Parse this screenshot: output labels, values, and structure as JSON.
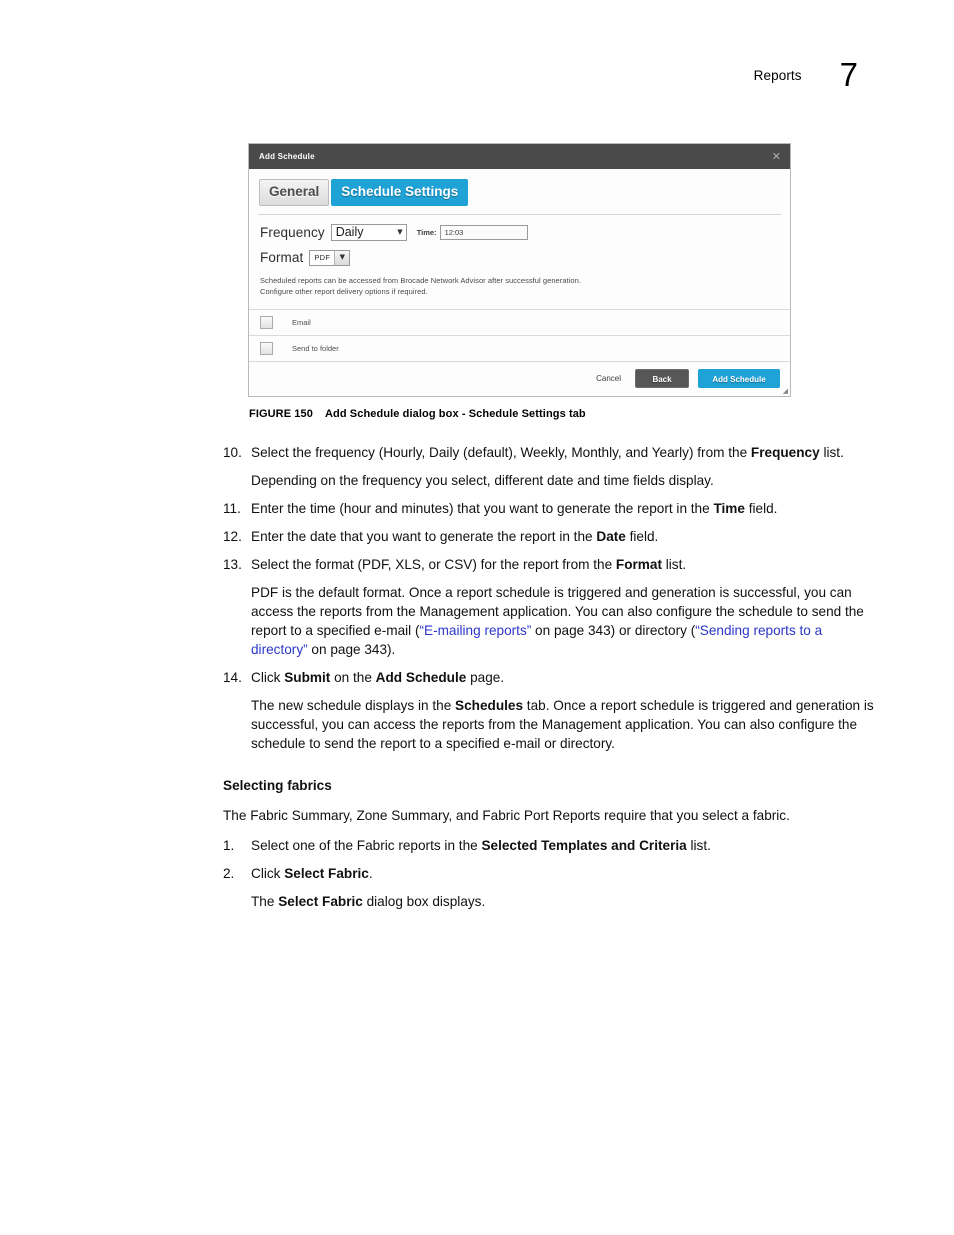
{
  "header": {
    "label": "Reports",
    "chapter_number": "7"
  },
  "dialog": {
    "title": "Add Schedule",
    "close_icon": "close-icon",
    "tabs": [
      {
        "label": "General",
        "active": false
      },
      {
        "label": "Schedule Settings",
        "active": true
      }
    ],
    "frequency": {
      "label": "Frequency",
      "value": "Daily",
      "options": [
        "Hourly",
        "Daily",
        "Weekly",
        "Monthly",
        "Yearly"
      ]
    },
    "time": {
      "label": "Time:",
      "value": "12:03"
    },
    "format": {
      "label": "Format",
      "value": "PDF",
      "options": [
        "PDF",
        "XLS",
        "CSV"
      ]
    },
    "note_line1": "Scheduled reports can be accessed from Brocade Network Advisor after successful generation.",
    "note_line2": "Configure other report delivery options if required.",
    "delivery_options": [
      {
        "label": "Email",
        "checked": false
      },
      {
        "label": "Send to folder",
        "checked": false
      }
    ],
    "buttons": {
      "cancel": "Cancel",
      "back": "Back",
      "submit": "Add Schedule"
    },
    "colors": {
      "titlebar": "#4a4a4a",
      "accent": "#1fa2d6",
      "back_button": "#575757"
    }
  },
  "figure": {
    "number": "FIGURE 150",
    "caption": "Add Schedule dialog box - Schedule Settings tab"
  },
  "steps": {
    "s10": {
      "num": "10.",
      "text_a": "Select the frequency (Hourly, Daily (default), Weekly, Monthly, and Yearly) from the ",
      "bold": "Frequency",
      "text_b": " list."
    },
    "s10_note": "Depending on the frequency you select, different date and time fields display.",
    "s11": {
      "num": "11.",
      "text_a": "Enter the time (hour and minutes) that you want to generate the report in the ",
      "bold": "Time",
      "text_b": " field."
    },
    "s12": {
      "num": "12.",
      "text_a": "Enter the date that you want to generate the report in the ",
      "bold": "Date",
      "text_b": " field."
    },
    "s13": {
      "num": "13.",
      "text_a": "Select the format (PDF, XLS, or CSV) for the report from the ",
      "bold": "Format",
      "text_b": " list."
    },
    "s13_note": {
      "part_a": "PDF is the default format. Once a report schedule is triggered and generation is successful, you can access the reports from the Management application. You can also configure the schedule to send the report to a specified e-mail (",
      "link_a": "“E-mailing reports”",
      "part_b": " on page 343) or directory (",
      "link_b": "“Sending reports to a directory”",
      "part_c": " on page 343)."
    },
    "s14": {
      "num": "14.",
      "text_a": "Click ",
      "bold_a": "Submit",
      "text_b": " on the ",
      "bold_b": "Add Schedule",
      "text_c": " page."
    },
    "s14_note": {
      "part_a": "The new schedule displays in the ",
      "bold": "Schedules",
      "part_b": " tab. Once a report schedule is triggered and generation is successful, you can access the reports from the Management application. You can also configure the schedule to send the report to a specified e-mail or directory."
    }
  },
  "section": {
    "heading": "Selecting fabrics",
    "intro": "The Fabric Summary, Zone Summary, and Fabric Port Reports require that you select a fabric.",
    "s1": {
      "num": "1.",
      "text_a": "Select one of the Fabric reports in the ",
      "bold": "Selected Templates and Criteria",
      "text_b": " list."
    },
    "s2": {
      "num": "2.",
      "text_a": "Click ",
      "bold": "Select Fabric",
      "text_b": "."
    },
    "s2_note": {
      "part_a": "The ",
      "bold": "Select Fabric",
      "part_b": " dialog box displays."
    }
  }
}
